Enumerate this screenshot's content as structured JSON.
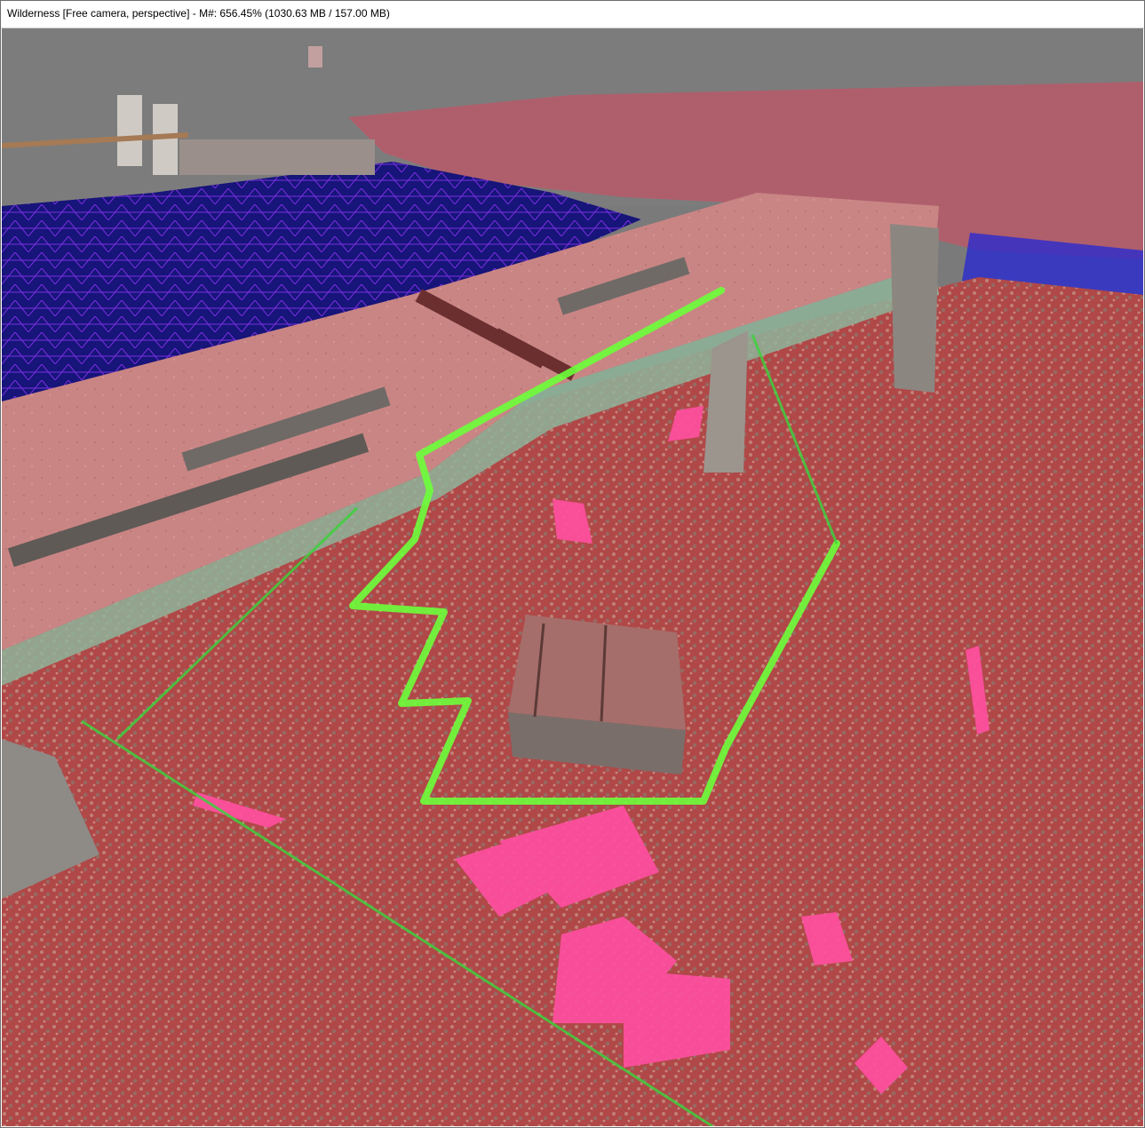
{
  "window": {
    "title": "Wilderness [Free camera, perspective] - M#: 656.45% (1030.63 MB / 157.00 MB)"
  },
  "viewport": {
    "camera": "free-perspective",
    "colors": {
      "sky": "#7c7c7c",
      "water": "#10106a",
      "terrain": "#b24a4a",
      "navmesh_highlight": "#ff4fa0",
      "path": "#6cff3a",
      "bridge": "#c98a86"
    }
  }
}
